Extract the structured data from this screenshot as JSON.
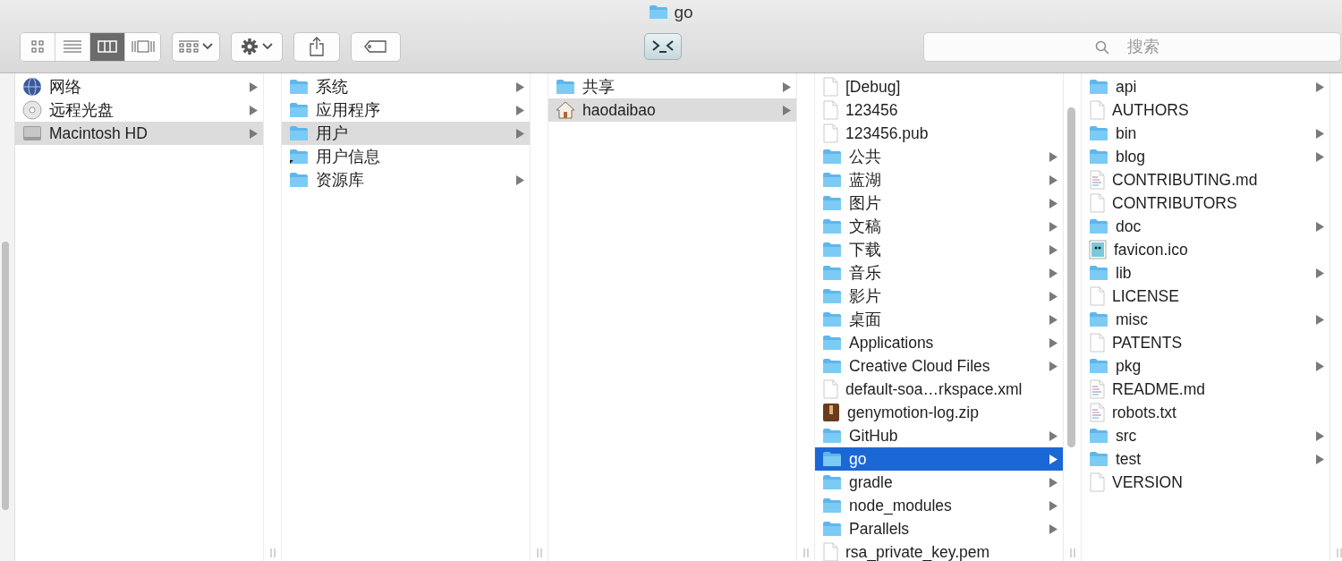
{
  "window": {
    "title": "go"
  },
  "toolbar": {
    "views": [
      {
        "kind": "icons",
        "selected": false
      },
      {
        "kind": "list",
        "selected": false
      },
      {
        "kind": "columns",
        "selected": true
      },
      {
        "kind": "gallery",
        "selected": false
      }
    ],
    "tools": [
      {
        "kind": "arrange"
      },
      {
        "kind": "action"
      },
      {
        "kind": "share"
      },
      {
        "kind": "tags"
      }
    ],
    "search": {
      "placeholder": "搜索"
    }
  },
  "columns": [
    {
      "active": false,
      "items": [
        {
          "name": "网络",
          "kind": "network",
          "selected": false,
          "expandable": true
        },
        {
          "name": "远程光盘",
          "kind": "disc",
          "selected": false,
          "expandable": true
        },
        {
          "name": "Macintosh HD",
          "kind": "drive",
          "selected": true,
          "expandable": true
        }
      ]
    },
    {
      "active": false,
      "items": [
        {
          "name": "系统",
          "kind": "folder",
          "selected": false,
          "expandable": true
        },
        {
          "name": "应用程序",
          "kind": "folder",
          "selected": false,
          "expandable": true
        },
        {
          "name": "用户",
          "kind": "folder",
          "selected": true,
          "expandable": true
        },
        {
          "name": "用户信息",
          "kind": "alias",
          "selected": false,
          "expandable": false
        },
        {
          "name": "资源库",
          "kind": "folder",
          "selected": false,
          "expandable": true
        }
      ]
    },
    {
      "active": false,
      "items": [
        {
          "name": "共享",
          "kind": "folder",
          "selected": false,
          "expandable": true
        },
        {
          "name": "haodaibao",
          "kind": "home",
          "selected": true,
          "expandable": true
        }
      ]
    },
    {
      "active": true,
      "items": [
        {
          "name": "[Debug]",
          "kind": "file",
          "selected": false,
          "expandable": false
        },
        {
          "name": "123456",
          "kind": "file",
          "selected": false,
          "expandable": false
        },
        {
          "name": "123456.pub",
          "kind": "file",
          "selected": false,
          "expandable": false
        },
        {
          "name": "公共",
          "kind": "folder",
          "selected": false,
          "expandable": true
        },
        {
          "name": "蓝湖",
          "kind": "folder",
          "selected": false,
          "expandable": true
        },
        {
          "name": "图片",
          "kind": "folder",
          "selected": false,
          "expandable": true
        },
        {
          "name": "文稿",
          "kind": "folder",
          "selected": false,
          "expandable": true
        },
        {
          "name": "下载",
          "kind": "folder",
          "selected": false,
          "expandable": true
        },
        {
          "name": "音乐",
          "kind": "folder",
          "selected": false,
          "expandable": true
        },
        {
          "name": "影片",
          "kind": "folder",
          "selected": false,
          "expandable": true
        },
        {
          "name": "桌面",
          "kind": "folder",
          "selected": false,
          "expandable": true
        },
        {
          "name": "Applications",
          "kind": "folder",
          "selected": false,
          "expandable": true
        },
        {
          "name": "Creative Cloud Files",
          "kind": "folder",
          "selected": false,
          "expandable": true
        },
        {
          "name": "default-soa…rkspace.xml",
          "kind": "file",
          "selected": false,
          "expandable": false
        },
        {
          "name": "genymotion-log.zip",
          "kind": "archive",
          "selected": false,
          "expandable": false
        },
        {
          "name": "GitHub",
          "kind": "folder",
          "selected": false,
          "expandable": true
        },
        {
          "name": "go",
          "kind": "folder",
          "selected": true,
          "expandable": true
        },
        {
          "name": "gradle",
          "kind": "folder",
          "selected": false,
          "expandable": true
        },
        {
          "name": "node_modules",
          "kind": "folder",
          "selected": false,
          "expandable": true
        },
        {
          "name": "Parallels",
          "kind": "folder",
          "selected": false,
          "expandable": true
        },
        {
          "name": "rsa_private_key.pem",
          "kind": "file",
          "selected": false,
          "expandable": false
        }
      ]
    },
    {
      "active": false,
      "items": [
        {
          "name": "api",
          "kind": "folder",
          "selected": false,
          "expandable": true
        },
        {
          "name": "AUTHORS",
          "kind": "file",
          "selected": false,
          "expandable": false
        },
        {
          "name": "bin",
          "kind": "folder",
          "selected": false,
          "expandable": true
        },
        {
          "name": "blog",
          "kind": "folder",
          "selected": false,
          "expandable": true
        },
        {
          "name": "CONTRIBUTING.md",
          "kind": "text",
          "selected": false,
          "expandable": false
        },
        {
          "name": "CONTRIBUTORS",
          "kind": "file",
          "selected": false,
          "expandable": false
        },
        {
          "name": "doc",
          "kind": "folder",
          "selected": false,
          "expandable": true
        },
        {
          "name": "favicon.ico",
          "kind": "image",
          "selected": false,
          "expandable": false
        },
        {
          "name": "lib",
          "kind": "folder",
          "selected": false,
          "expandable": true
        },
        {
          "name": "LICENSE",
          "kind": "file",
          "selected": false,
          "expandable": false
        },
        {
          "name": "misc",
          "kind": "folder",
          "selected": false,
          "expandable": true
        },
        {
          "name": "PATENTS",
          "kind": "file",
          "selected": false,
          "expandable": false
        },
        {
          "name": "pkg",
          "kind": "folder",
          "selected": false,
          "expandable": true
        },
        {
          "name": "README.md",
          "kind": "text",
          "selected": false,
          "expandable": false
        },
        {
          "name": "robots.txt",
          "kind": "text",
          "selected": false,
          "expandable": false
        },
        {
          "name": "src",
          "kind": "folder",
          "selected": false,
          "expandable": true
        },
        {
          "name": "test",
          "kind": "folder",
          "selected": false,
          "expandable": true
        },
        {
          "name": "VERSION",
          "kind": "file",
          "selected": false,
          "expandable": false
        }
      ]
    }
  ]
}
